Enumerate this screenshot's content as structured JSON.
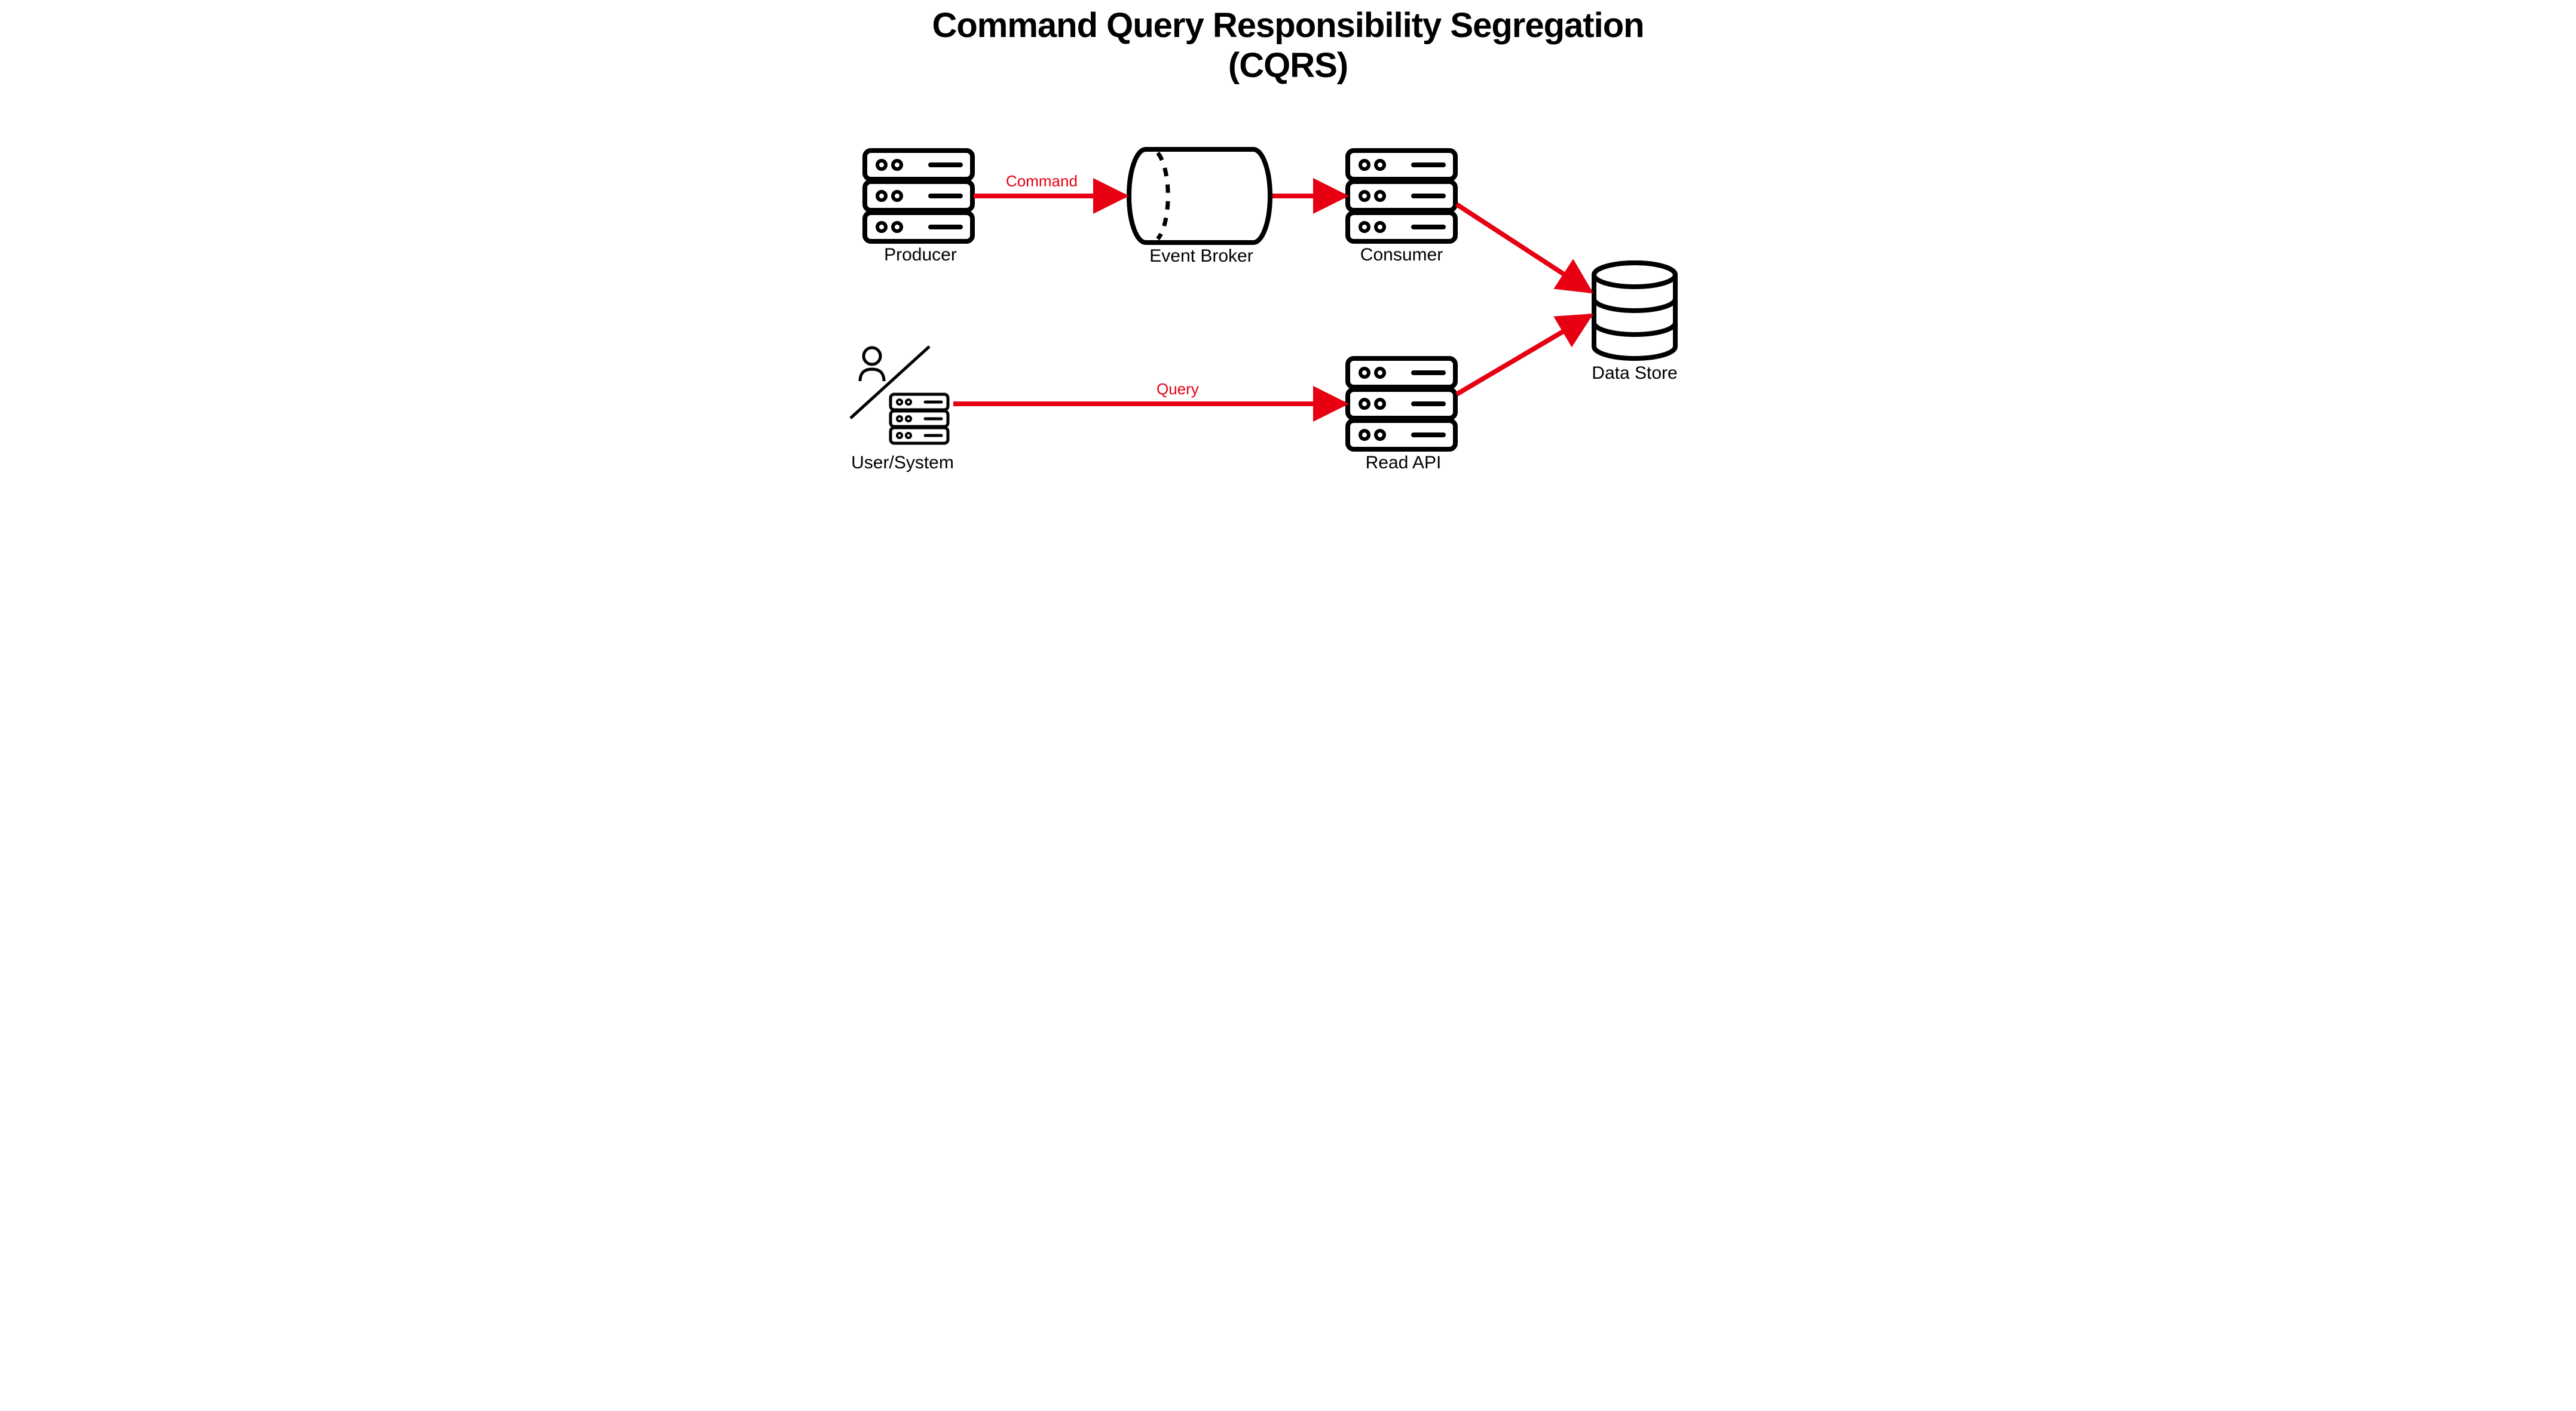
{
  "title_line1": "Command Query Responsibility  Segregation",
  "title_line2": "(CQRS)",
  "nodes": {
    "producer": {
      "label": "Producer"
    },
    "eventBroker": {
      "label": "Event Broker"
    },
    "consumer": {
      "label": "Consumer"
    },
    "dataStore": {
      "label": "Data Store"
    },
    "userSystem": {
      "label": "User/System"
    },
    "readApi": {
      "label": "Read API"
    }
  },
  "edges": {
    "command": {
      "label": "Command"
    },
    "query": {
      "label": "Query"
    }
  },
  "colors": {
    "arrow": "#e60012",
    "stroke": "#000000"
  }
}
